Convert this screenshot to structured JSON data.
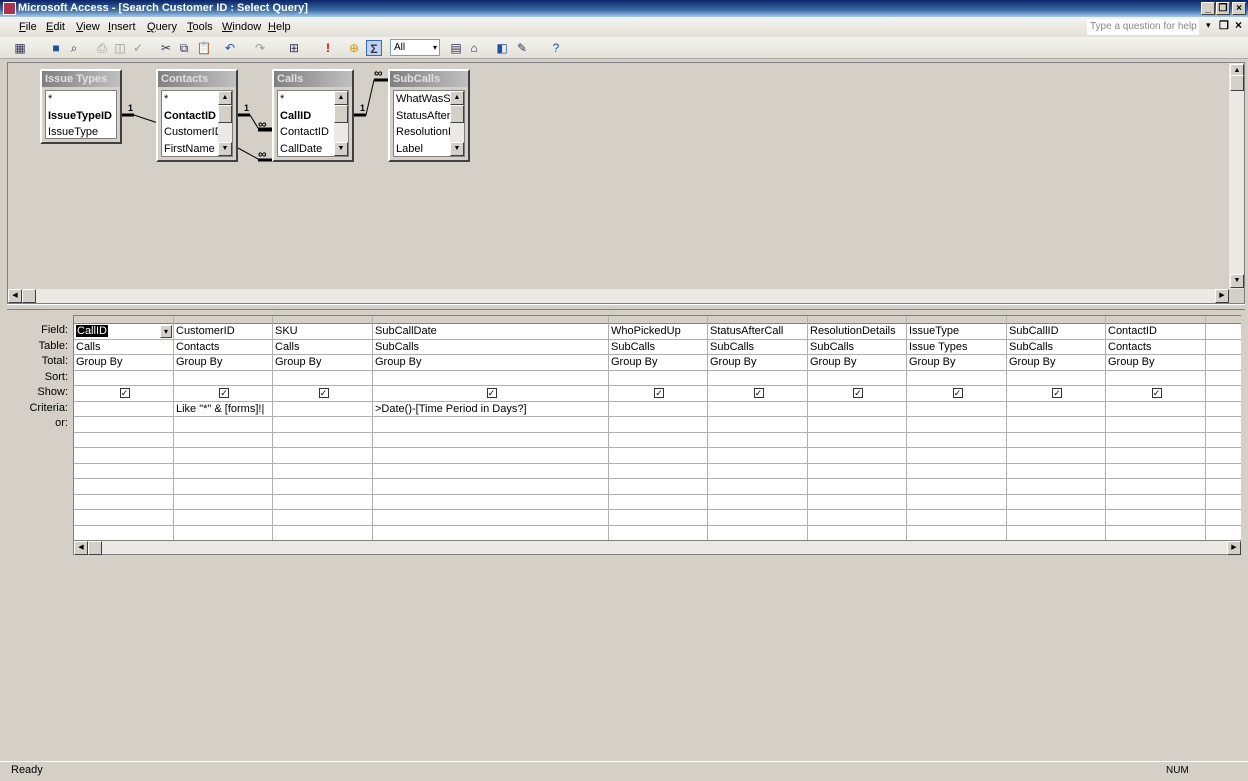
{
  "window": {
    "title": "Microsoft Access - [Search Customer ID : Select Query]"
  },
  "menu": [
    "File",
    "Edit",
    "View",
    "Insert",
    "Query",
    "Tools",
    "Window",
    "Help"
  ],
  "help_placeholder": "Type a question for help",
  "toolbar": {
    "top_values": "All"
  },
  "tables": [
    {
      "name": "Issue Types",
      "fields": [
        "*",
        "IssueTypeID",
        "IssueType"
      ],
      "pk": "IssueTypeID"
    },
    {
      "name": "Contacts",
      "fields": [
        "*",
        "ContactID",
        "CustomerID",
        "FirstName"
      ],
      "pk": "ContactID"
    },
    {
      "name": "Calls",
      "fields": [
        "*",
        "CallID",
        "ContactID",
        "CallDate"
      ],
      "pk": "CallID"
    },
    {
      "name": "SubCalls",
      "fields": [
        "WhatWasSa",
        "StatusAfterC",
        "ResolutionD",
        "Label"
      ],
      "pk": ""
    }
  ],
  "relations": {
    "one": "1",
    "many": "∞"
  },
  "grid": {
    "row_labels": [
      "Field:",
      "Table:",
      "Total:",
      "Sort:",
      "Show:",
      "Criteria:",
      "or:"
    ],
    "columns": [
      {
        "field": "CallID",
        "table": "Calls",
        "total": "Group By",
        "sort": "",
        "show": true,
        "criteria": ""
      },
      {
        "field": "CustomerID",
        "table": "Contacts",
        "total": "Group By",
        "sort": "",
        "show": true,
        "criteria": "Like \"*\" & [forms]!|"
      },
      {
        "field": "SKU",
        "table": "Calls",
        "total": "Group By",
        "sort": "",
        "show": true,
        "criteria": ""
      },
      {
        "field": "SubCallDate",
        "table": "SubCalls",
        "total": "Group By",
        "sort": "",
        "show": true,
        "criteria": ">Date()-[Time Period in Days?]"
      },
      {
        "field": "WhoPickedUp",
        "table": "SubCalls",
        "total": "Group By",
        "sort": "",
        "show": true,
        "criteria": ""
      },
      {
        "field": "StatusAfterCall",
        "table": "SubCalls",
        "total": "Group By",
        "sort": "",
        "show": true,
        "criteria": ""
      },
      {
        "field": "ResolutionDetails",
        "table": "SubCalls",
        "total": "Group By",
        "sort": "",
        "show": true,
        "criteria": ""
      },
      {
        "field": "IssueType",
        "table": "Issue Types",
        "total": "Group By",
        "sort": "",
        "show": true,
        "criteria": ""
      },
      {
        "field": "SubCallID",
        "table": "SubCalls",
        "total": "Group By",
        "sort": "",
        "show": true,
        "criteria": ""
      },
      {
        "field": "ContactID",
        "table": "Contacts",
        "total": "Group By",
        "sort": "",
        "show": true,
        "criteria": ""
      },
      {
        "field": "",
        "table": "",
        "total": "",
        "sort": "",
        "show": false,
        "criteria": ""
      }
    ]
  },
  "status": {
    "left": "Ready",
    "num": "NUM"
  }
}
